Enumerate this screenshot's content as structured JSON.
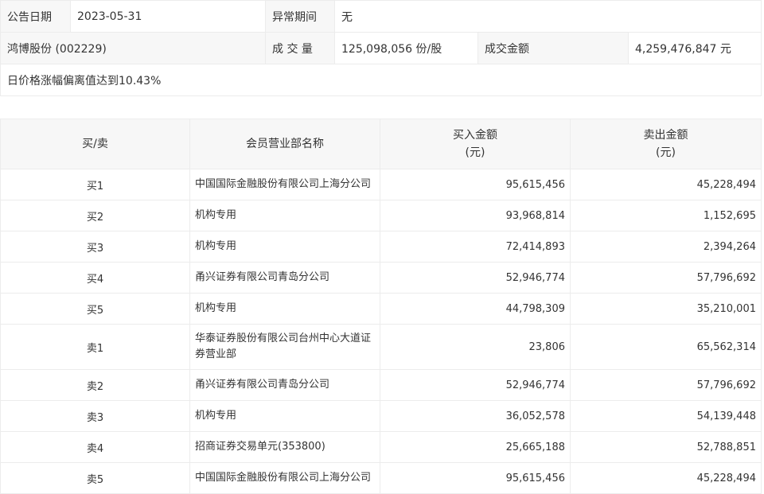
{
  "summary": {
    "date_label": "公告日期",
    "date_value": "2023-05-31",
    "period_label": "异常期间",
    "period_value": "无",
    "stock": "鸿博股份 (002229)",
    "volume_label": "成 交 量",
    "volume_value": "125,098,056 份/股",
    "amount_label": "成交金额",
    "amount_value": "4,259,476,847 元",
    "reason": "日价格涨幅偏离值达到10.43%"
  },
  "table": {
    "headers": {
      "side": "买/卖",
      "branch": "会员营业部名称",
      "buy_line1": "买入金额",
      "buy_line2": "(元)",
      "sell_line1": "卖出金额",
      "sell_line2": "(元)"
    },
    "rows": [
      {
        "side": "买1",
        "branch": "中国国际金融股份有限公司上海分公司",
        "buy": "95,615,456",
        "sell": "45,228,494"
      },
      {
        "side": "买2",
        "branch": "机构专用",
        "buy": "93,968,814",
        "sell": "1,152,695"
      },
      {
        "side": "买3",
        "branch": "机构专用",
        "buy": "72,414,893",
        "sell": "2,394,264"
      },
      {
        "side": "买4",
        "branch": "甬兴证券有限公司青岛分公司",
        "buy": "52,946,774",
        "sell": "57,796,692"
      },
      {
        "side": "买5",
        "branch": "机构专用",
        "buy": "44,798,309",
        "sell": "35,210,001"
      },
      {
        "side": "卖1",
        "branch": "华泰证券股份有限公司台州中心大道证券营业部",
        "buy": "23,806",
        "sell": "65,562,314"
      },
      {
        "side": "卖2",
        "branch": "甬兴证券有限公司青岛分公司",
        "buy": "52,946,774",
        "sell": "57,796,692"
      },
      {
        "side": "卖3",
        "branch": "机构专用",
        "buy": "36,052,578",
        "sell": "54,139,448"
      },
      {
        "side": "卖4",
        "branch": "招商证券交易单元(353800)",
        "buy": "25,665,188",
        "sell": "52,788,851"
      },
      {
        "side": "卖5",
        "branch": "中国国际金融股份有限公司上海分公司",
        "buy": "95,615,456",
        "sell": "45,228,494"
      }
    ]
  }
}
